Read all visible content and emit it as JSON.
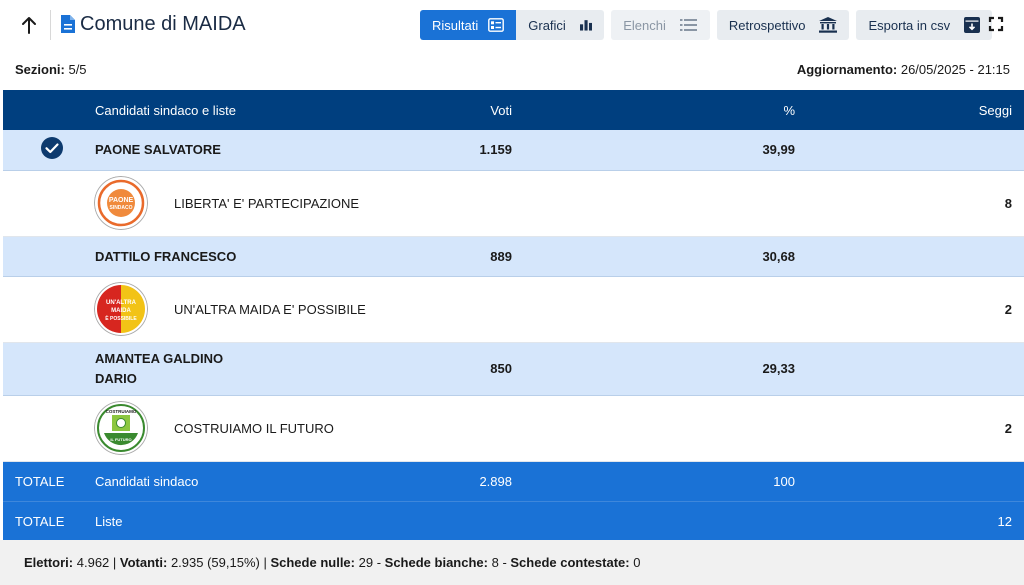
{
  "header": {
    "title": "Comune di MAIDA",
    "buttons": {
      "risultati": "Risultati",
      "grafici": "Grafici",
      "elenchi": "Elenchi",
      "retrospettivo": "Retrospettivo",
      "esporta": "Esporta in csv"
    }
  },
  "meta": {
    "sezioni_label": "Sezioni:",
    "sezioni_value": "5/5",
    "aggiornamento_label": "Aggiornamento:",
    "aggiornamento_value": "26/05/2025 - 21:15"
  },
  "table": {
    "columns": {
      "candidati": "Candidati sindaco e liste",
      "voti": "Voti",
      "percent": "%",
      "seggi": "Seggi"
    },
    "candidates": [
      {
        "name_line1": "PAONE SALVATORE",
        "name_line2": "",
        "voti": "1.159",
        "percent": "39,99",
        "elected": true,
        "list": {
          "name": "LIBERTA' E' PARTECIPAZIONE",
          "seggi": "8",
          "logo_text": "PAONE SINDACO",
          "logo_colors": {
            "ring": "#e96a2b",
            "center": "#f08a3c"
          }
        }
      },
      {
        "name_line1": "DATTILO FRANCESCO",
        "name_line2": "",
        "voti": "889",
        "percent": "30,68",
        "elected": false,
        "list": {
          "name": "UN'ALTRA MAIDA E' POSSIBILE",
          "seggi": "2",
          "logo_text_1": "UN'ALTRA",
          "logo_text_2": "MAIDA",
          "logo_text_3": "È POSSIBILE",
          "logo_colors": {
            "left": "#d7261f",
            "right": "#f2c316"
          }
        }
      },
      {
        "name_line1": "AMANTEA GALDINO",
        "name_line2": "DARIO",
        "voti": "850",
        "percent": "29,33",
        "elected": false,
        "list": {
          "name": "COSTRUIAMO IL FUTURO",
          "seggi": "2",
          "logo_text": "COSTRUIAMO IL FUTURO",
          "logo_colors": {
            "ring": "#3a8a2f",
            "center": "#8cc63f"
          }
        }
      }
    ],
    "totals": [
      {
        "label": "TOTALE",
        "desc": "Candidati sindaco",
        "voti": "2.898",
        "percent": "100",
        "seggi": ""
      },
      {
        "label": "TOTALE",
        "desc": "Liste",
        "voti": "",
        "percent": "",
        "seggi": "12"
      }
    ]
  },
  "footer": {
    "elettori_label": "Elettori:",
    "elettori_value": "4.962",
    "votanti_label": "Votanti:",
    "votanti_value": "2.935 (59,15%)",
    "nulle_label": "Schede nulle:",
    "nulle_value": "29",
    "bianche_label": "Schede bianche:",
    "bianche_value": "8",
    "contestate_label": "Schede contestate:",
    "contestate_value": "0"
  },
  "colors": {
    "header_row": "#003f7f",
    "candidate_row": "#d5e6fb",
    "total_row": "#1a72d6",
    "active_button": "#1a72d6",
    "check_icon": "#0d3a6e"
  },
  "icons": {
    "back": "arrow-up-icon",
    "document": "document-icon",
    "risultati": "list-detail-icon",
    "grafici": "bar-chart-icon",
    "elenchi": "list-icon",
    "retrospettivo": "bank-icon",
    "esporta": "archive-download-icon",
    "fullscreen": "fullscreen-icon",
    "elected": "check-circle-icon"
  }
}
